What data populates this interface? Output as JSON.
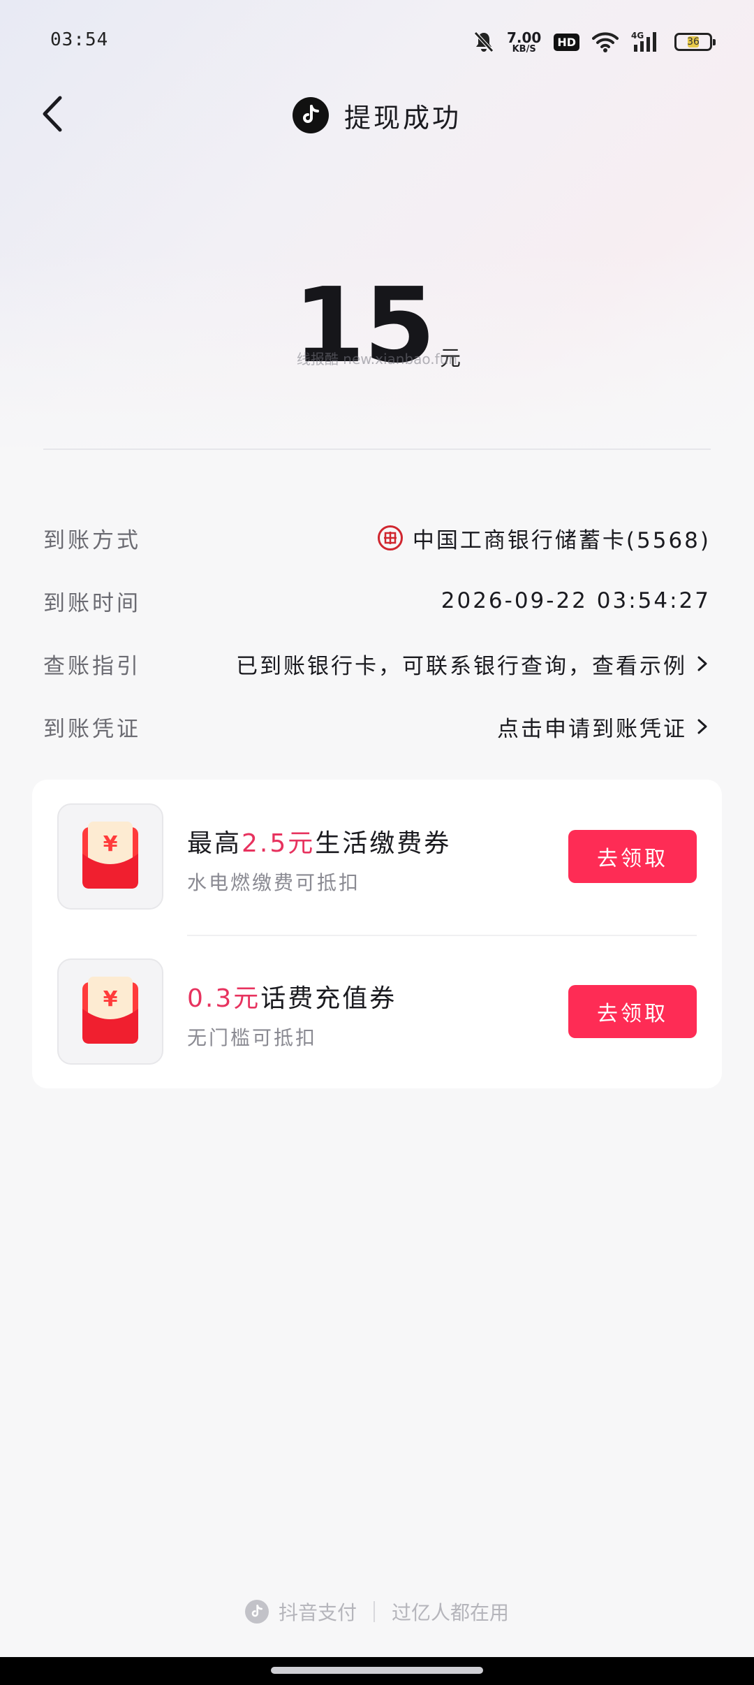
{
  "status_bar": {
    "time": "03:54",
    "net_speed_value": "7.00",
    "net_speed_unit": "KB/S",
    "hd_label": "HD",
    "signal_label": "4G",
    "battery_level": "36",
    "icons": [
      "bell-off-icon",
      "wifi-icon",
      "signal-icon",
      "battery-icon"
    ]
  },
  "header": {
    "back_icon": "chevron-left-icon",
    "logo_icon": "tiktok-logo-icon",
    "title": "提现成功"
  },
  "amount": {
    "value": "15",
    "unit": "元",
    "watermark": "线报酷 new.xianbao.fun"
  },
  "details": [
    {
      "label": "到账方式",
      "value": "中国工商银行储蓄卡(5568)",
      "icon": "icbc-bank-icon"
    },
    {
      "label": "到账时间",
      "value": "2026-09-22 03:54:27"
    },
    {
      "label": "查账指引",
      "value": "已到账银行卡，可联系银行查询，查看示例"
    },
    {
      "label": "到账凭证",
      "value": "点击申请到账凭证"
    }
  ],
  "coupons": [
    {
      "title_prefix": "最高",
      "title_highlight": "2.5元",
      "title_suffix": "生活缴费券",
      "subtitle": "水电燃缴费可抵扣",
      "button": "去领取",
      "icon": "red-envelope-icon"
    },
    {
      "title_prefix": "",
      "title_highlight": "0.3元",
      "title_suffix": "话费充值券",
      "subtitle": "无门槛可抵扣",
      "button": "去领取",
      "icon": "red-envelope-icon"
    }
  ],
  "footer": {
    "brand": "抖音支付",
    "slogan": "过亿人都在用"
  },
  "colors": {
    "accent": "#fe2c55",
    "highlight": "#e7325e",
    "bank_red": "#d0262f"
  }
}
